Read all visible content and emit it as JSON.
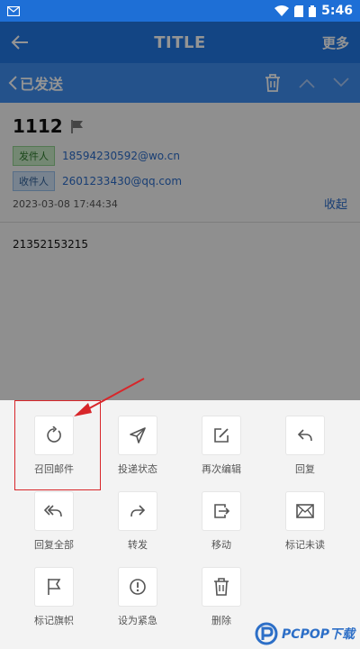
{
  "status_bar": {
    "time": "5:46"
  },
  "header": {
    "title": "TITLE",
    "more_label": "更多"
  },
  "subbar": {
    "back_label": "已发送"
  },
  "mail": {
    "subject": "1112",
    "from_tag": "发件人",
    "from_email": "18594230592@wo.cn",
    "to_tag": "收件人",
    "to_email": "2601233430@qq.com",
    "date": "2023-03-08 17:44:34",
    "collapse_label": "收起",
    "body": "21352153215"
  },
  "actions": [
    {
      "label": "召回邮件",
      "icon": "recall-icon"
    },
    {
      "label": "投递状态",
      "icon": "send-icon"
    },
    {
      "label": "再次编辑",
      "icon": "edit-icon"
    },
    {
      "label": "回复",
      "icon": "reply-icon"
    },
    {
      "label": "回复全部",
      "icon": "reply-all-icon"
    },
    {
      "label": "转发",
      "icon": "forward-icon"
    },
    {
      "label": "移动",
      "icon": "move-icon"
    },
    {
      "label": "标记未读",
      "icon": "mail-icon"
    },
    {
      "label": "标记旗帜",
      "icon": "flag-icon"
    },
    {
      "label": "设为紧急",
      "icon": "urgent-icon"
    },
    {
      "label": "删除",
      "icon": "delete-icon"
    }
  ],
  "watermark": {
    "text": "PCPOP下载"
  },
  "colors": {
    "primary": "#2277e3",
    "subbar": "#3f8ef0",
    "link": "#2b6cc8",
    "highlight": "#d8262a"
  }
}
